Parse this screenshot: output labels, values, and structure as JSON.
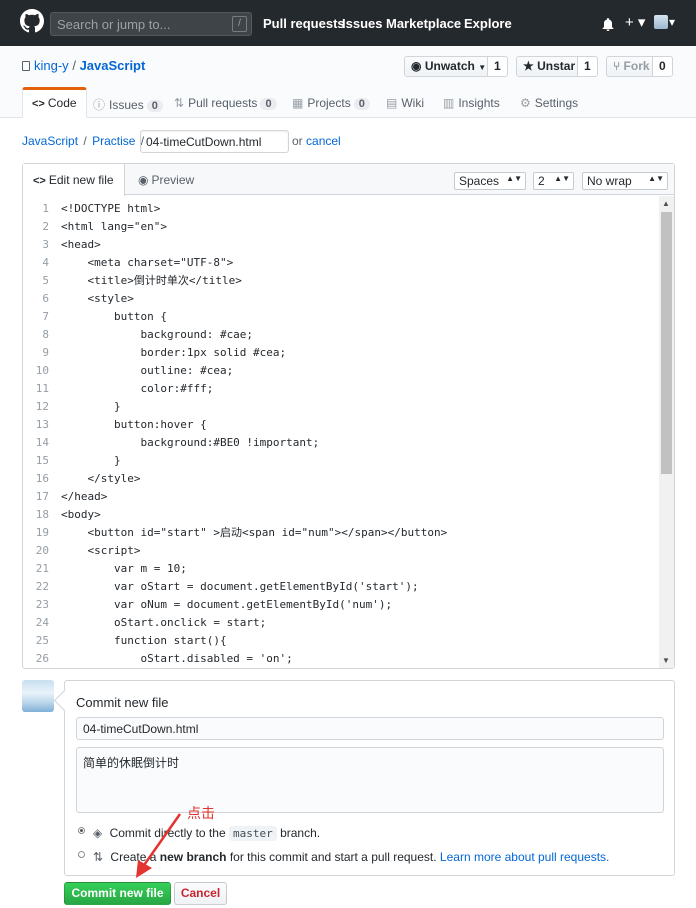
{
  "header": {
    "search_placeholder": "Search or jump to...",
    "slash_key": "/",
    "nav": [
      "Pull requests",
      "Issues",
      "Marketplace",
      "Explore"
    ],
    "plus": "+ ▾",
    "caret": "▾"
  },
  "repo": {
    "owner": "king-y",
    "separator": "/",
    "name": "JavaScript",
    "unwatch_label": "Unwatch",
    "watch_count": "1",
    "unstar_label": "Unstar",
    "star_count": "1",
    "fork_label": "Fork",
    "fork_count": "0"
  },
  "tabs": {
    "code": "Code",
    "issues": "Issues",
    "issues_count": "0",
    "pulls": "Pull requests",
    "pulls_count": "0",
    "projects": "Projects",
    "projects_count": "0",
    "wiki": "Wiki",
    "insights": "Insights",
    "settings": "Settings"
  },
  "breadcrumb": {
    "repo": "JavaScript",
    "sep": "/",
    "folder": "Practise",
    "filename": "04-timeCutDown.html",
    "or": "or",
    "cancel": "cancel"
  },
  "editor": {
    "edit_tab": "Edit new file",
    "preview_tab": "Preview",
    "indent_mode": "Spaces",
    "indent_size": "2",
    "wrap_mode": "No wrap",
    "lines": [
      "<!DOCTYPE html>",
      "<html lang=\"en\">",
      "<head>",
      "    <meta charset=\"UTF-8\">",
      "    <title>倒计时单次</title>",
      "    <style>",
      "        button {",
      "            background: #cae;",
      "            border:1px solid #cea;",
      "            outline: #cea;",
      "            color:#fff;",
      "        }",
      "        button:hover {",
      "            background:#BE0 !important;",
      "        }",
      "    </style>",
      "</head>",
      "<body>",
      "    <button id=\"start\" >启动<span id=\"num\"></span></button>",
      "    <script>",
      "        var m = 10;",
      "        var oStart = document.getElementById('start');",
      "        var oNum = document.getElementById('num');",
      "        oStart.onclick = start;",
      "        function start(){",
      "            oStart.disabled = 'on';"
    ]
  },
  "commit": {
    "title": "Commit new file",
    "summary_value": "04-timeCutDown.html",
    "description_value": "简单的休眠倒计时",
    "option1_prefix": "Commit directly to the",
    "option1_branch": "master",
    "option1_suffix": "branch.",
    "option2_prefix": "Create a",
    "option2_bold": "new branch",
    "option2_middle": "for this commit and start a pull request.",
    "option2_link": "Learn more about pull requests.",
    "submit": "Commit new file",
    "cancel": "Cancel"
  },
  "annotation": {
    "text": "点击",
    "color": "#e3342f"
  }
}
